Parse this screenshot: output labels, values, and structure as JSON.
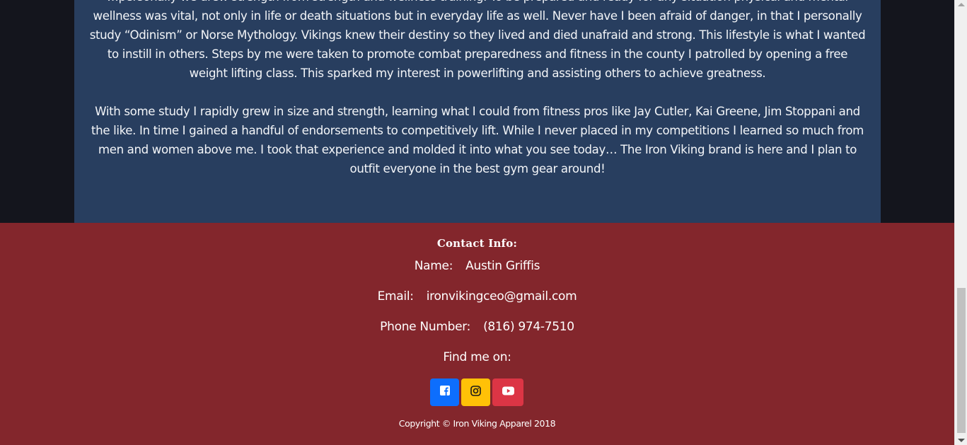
{
  "about": {
    "paragraph1": "…personally we drew strength from strength and wellness training. To be prepared and ready for any situation physical and mental wellness was vital, not only in life or death situations but in everyday life as well. Never have I been afraid of danger, in that I personally study “Odinism” or Norse Mythology. Vikings knew their destiny so they lived and died unafraid and strong. This lifestyle is what I wanted to instill in others. Steps by me were taken to promote combat preparedness and fitness in the county I patrolled by opening a free weight lifting class. This sparked my interest in powerlifting and assisting others to achieve greatness.",
    "paragraph2": "With some study I rapidly grew in size and strength, learning what I could from fitness pros like Jay Cutler, Kai Greene, Jim Stoppani and the like. In time I gained a handful of endorsements to competitively lift. While I never placed in my competitions I learned so much from men and women above me. I took that experience and molded it into what you see today… The Iron Viking brand is here and I plan to outfit everyone in the best gym gear around!"
  },
  "contact": {
    "title": "Contact Info:",
    "name_label": "Name:",
    "name_value": "Austin Griffis",
    "email_label": "Email:",
    "email_value": "ironvikingceo@gmail.com",
    "phone_label": "Phone Number:",
    "phone_value": "(816) 974-7510",
    "find_me": "Find me on:"
  },
  "social": [
    {
      "name": "facebook",
      "icon": "facebook-icon",
      "color": "#0d6efd"
    },
    {
      "name": "instagram",
      "icon": "instagram-icon",
      "color": "#ffc107"
    },
    {
      "name": "youtube",
      "icon": "youtube-icon",
      "color": "#dc3545"
    }
  ],
  "copyright": "Copyright © Iron Viking Apparel 2018",
  "colors": {
    "page_bg": "#14151d",
    "about_bg": "#283e5f",
    "footer_bg": "#83262c"
  }
}
